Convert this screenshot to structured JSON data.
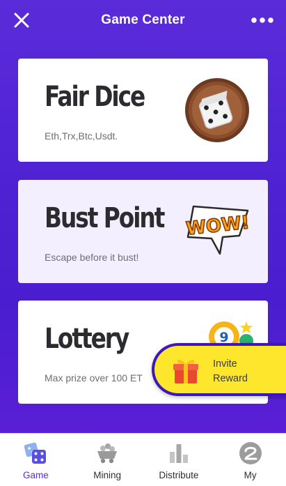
{
  "header": {
    "title": "Game Center",
    "close_icon": "close-icon",
    "more_icon": "more-horizontal-icon"
  },
  "games": [
    {
      "name": "Fair Dice",
      "description": "Eth,Trx,Btc,Usdt.",
      "art": "dice-icon"
    },
    {
      "name": "Bust Point",
      "description": "Escape before it bust!",
      "art": "wow-burst-icon"
    },
    {
      "name": "Lottery",
      "description": "Max prize over 100 ET",
      "art": "lottery-balls-icon"
    }
  ],
  "invite": {
    "line1": "Invite",
    "line2": "Reward",
    "icon": "gift-icon"
  },
  "tabs": [
    {
      "label": "Game",
      "icon": "dice-icon",
      "active": true
    },
    {
      "label": "Mining",
      "icon": "mining-cart-icon",
      "active": false
    },
    {
      "label": "Distribute",
      "icon": "bar-chart-icon",
      "active": false
    },
    {
      "label": "My",
      "icon": "profile-icon",
      "active": false
    }
  ],
  "colors": {
    "accent": "#5a2bd9",
    "invite_bg": "#fde62b",
    "card_highlight": "#f3efff"
  }
}
